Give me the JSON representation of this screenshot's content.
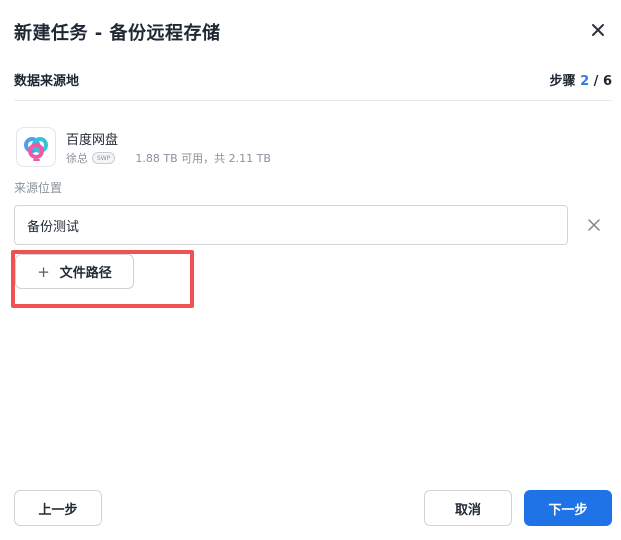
{
  "dialog": {
    "title": "新建任务 - 备份远程存储",
    "close_icon": "close-icon"
  },
  "section": {
    "title": "数据来源地",
    "step_label": "步骤",
    "step_current": "2",
    "step_sep": " / ",
    "step_total": "6"
  },
  "source": {
    "name": "百度网盘",
    "user": "徐总",
    "badge": "SWP",
    "capacity": "1.88 TB 可用，共 2.11 TB",
    "logo_icon": "baidu-netdisk-logo"
  },
  "location": {
    "label": "来源位置",
    "value": "备份测试",
    "clear_icon": "clear-icon"
  },
  "add_path": {
    "plus": "+",
    "label": "文件路径"
  },
  "footer": {
    "prev": "上一步",
    "cancel": "取消",
    "next": "下一步"
  },
  "colors": {
    "accent": "#1f73e6",
    "step_highlight": "#2f7bea",
    "annotation": "#ee5253"
  }
}
